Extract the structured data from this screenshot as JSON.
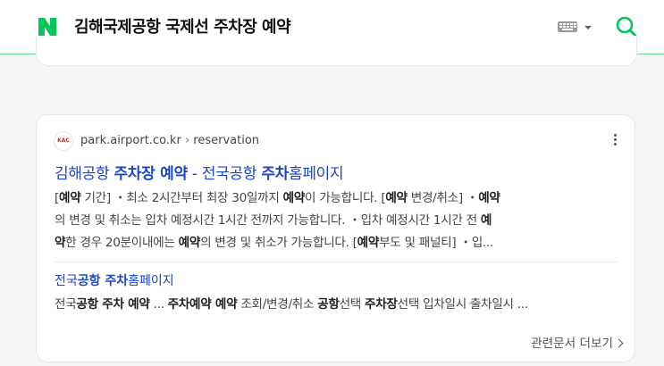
{
  "header": {
    "logo_letter": "N",
    "query": "김해국제공항 국제선 주차장 예약",
    "colors": {
      "brand": "#03c75a",
      "divider": "#5ed68a"
    },
    "icons": [
      "naver-logo-icon",
      "keyboard-icon",
      "chevron-down-icon",
      "search-icon"
    ]
  },
  "result": {
    "favicon_text": "KAC",
    "domain": "park.airport.co.kr",
    "path_sep": "›",
    "path": "reservation",
    "title_parts": [
      "김해공항 ",
      "주차장 예약",
      " - 전국공항 ",
      "주차",
      "홈페이지"
    ],
    "desc_lines": [
      [
        "[",
        "예약",
        " 기간] ・최소 2시간부터 최장 30일까지 ",
        "예약",
        "이 가능합니다. [",
        "예약",
        " 변경/취소] ・",
        "예약"
      ],
      [
        "의 변경 및 취소는 입차 예정시간 1시간 전까지 가능합니다. ・입차 예정시간 1시간 전 ",
        "예"
      ],
      [
        "약",
        "한 경우 20분이내에는 ",
        "예약",
        "의 변경 및 취소가 가능합니다. [",
        "예약",
        "부도 및 패널티] ・입..."
      ]
    ],
    "sub_title_parts": [
      "전국",
      "공항 주차",
      "홈페이지"
    ],
    "sub_desc_parts": [
      "전국",
      "공항 주차 예약",
      " ... ",
      "주차예약 예약",
      " 조회/변경/취소 ",
      "공항",
      "선택 ",
      "주차장",
      "선택 입차일시 출차일시 ..."
    ],
    "related_label": "관련문서 더보기"
  }
}
